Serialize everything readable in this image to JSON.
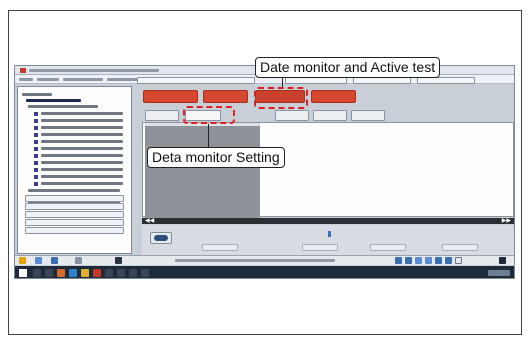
{
  "callouts": {
    "top": "Date monitor and Active test",
    "bottom": "Deta monitor Setting"
  },
  "colors": {
    "highlight": "#e02020",
    "tab_red": "#d5472f",
    "taskbar": "#1d2a3a",
    "data_column": "#8e9299"
  },
  "icons": {
    "go_button": "go-icon",
    "windows": "windows-logo-icon",
    "scroll_left": "scroll-left-icon",
    "scroll_right": "scroll-right-icon"
  },
  "scroll": {
    "left_glyph": "◀◀",
    "right_glyph": "▶▶"
  }
}
